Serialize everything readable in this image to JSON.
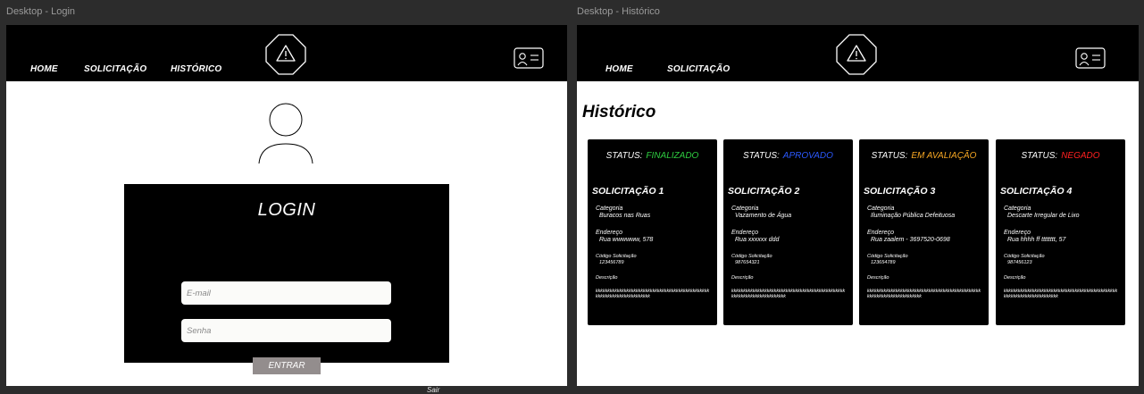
{
  "login_frame": {
    "label": "Desktop - Login",
    "nav": [
      "HOME",
      "SOLICITAÇÃO",
      "HISTÓRICO"
    ],
    "login_title": "LOGIN",
    "email_placeholder": "E-mail",
    "password_placeholder": "Senha",
    "enter_label": "ENTRAR",
    "exit_label": "Sair"
  },
  "history_frame": {
    "label": "Desktop - Histórico",
    "nav": [
      "HOME",
      "SOLICITAÇÃO"
    ],
    "title": "Histórico",
    "status_prefix": "STATUS:",
    "field_labels": {
      "category": "Categoria",
      "address": "Endereço",
      "code": "Código Solicitação",
      "description": "Descrição"
    },
    "cards": [
      {
        "status": "FINALIZADO",
        "status_color": "#2ecc40",
        "title": "SOLICITAÇÃO 1",
        "category": "Buracos nas Ruas",
        "address": "Rua wwwwww, 578",
        "code": "123456789",
        "description": "kkkkkkkkkkkkkkkkkkkkkkkkkkkkkkkkkkkkkkkkkkkkkkkkkkkkkkkkkkkkkkkkkkkkkkk"
      },
      {
        "status": "APROVADO",
        "status_color": "#2b59ff",
        "title": "SOLICITAÇÃO 2",
        "category": "Vazamento de Água",
        "address": "Rua xxxxxx ddd",
        "code": "987654321",
        "description": "kkkkkkkkkkkkkkkkkkkkkkkkkkkkkkkkkkkkkkkkkkkkkkkkkkkkkkkkkkkkkkkkkkkkkkk"
      },
      {
        "status": "EM AVALIAÇÃO",
        "status_color": "#f5a623",
        "title": "SOLICITAÇÃO 3",
        "category": "Iluminação Pública Defeituosa",
        "address": "Rua zaalem - 3697520-0698",
        "code": "123654789",
        "description": "kkkkkkkkkkkkkkkkkkkkkkkkkkkkkkkkkkkkkkkkkkkkkkkkkkkkkkkkkkkkkkkkkkkkkkk"
      },
      {
        "status": "NEGADO",
        "status_color": "#ff2020",
        "title": "SOLICITAÇÃO 4",
        "category": "Descarte Irregular de Lixo",
        "address": "Rua hhhh ff tttttttt, 57",
        "code": "987456123",
        "description": "kkkkkkkkkkkkkkkkkkkkkkkkkkkkkkkkkkkkkkkkkkkkkkkkkkkkkkkkkkkkkkkkkkkkkkk"
      }
    ]
  }
}
